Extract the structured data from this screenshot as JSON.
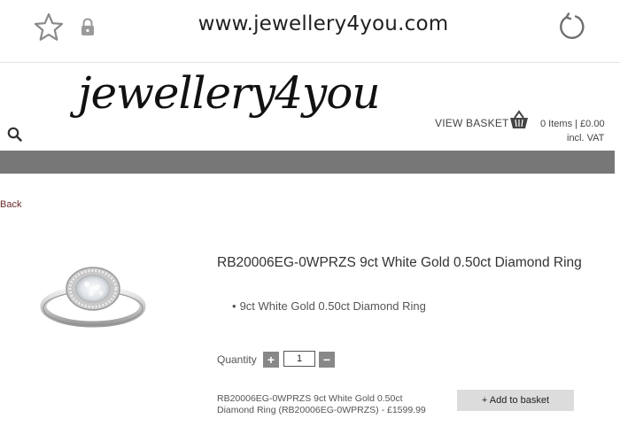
{
  "browser": {
    "url": "www.jewellery4you.com",
    "icons": [
      "star-icon",
      "lock-icon",
      "reload-icon"
    ]
  },
  "header": {
    "logo_text": "jewellery4you",
    "view_basket_label": "VIEW BASKET",
    "basket_summary": "0 Items | £0.00",
    "basket_vat": "incl. VAT"
  },
  "nav": {
    "back_label": "Back"
  },
  "product": {
    "title": "RB20006EG-0WPRZS 9ct White Gold 0.50ct Diamond Ring",
    "bullets": [
      "9ct White Gold 0.50ct Diamond Ring"
    ],
    "quantity_label": "Quantity",
    "quantity_value": "1",
    "plus_label": "+",
    "minus_label": "−",
    "summary": "RB20006EG-0WPRZS 9ct White Gold 0.50ct Diamond Ring (RB20006EG-0WPRZS) - £1599.99",
    "add_to_basket_label": "+ Add to basket"
  },
  "colors": {
    "nav_bar": "#777777",
    "back_link": "#6b2b2b",
    "button_bg": "#dcdcdc",
    "qty_buttons": "#888888"
  }
}
